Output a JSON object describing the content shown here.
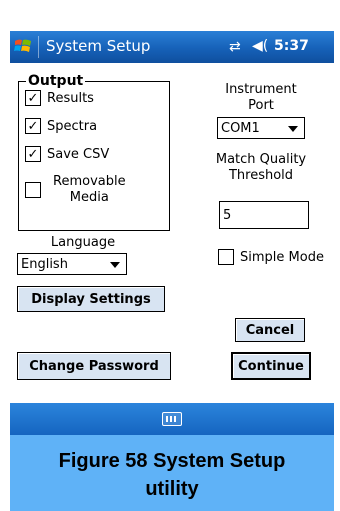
{
  "titlebar": {
    "title": "System Setup",
    "time": "5:37",
    "connectivity_icon": "⇄",
    "volume_icon": "◀("
  },
  "output_group": {
    "legend": "Output",
    "items": [
      {
        "label": "Results",
        "checked": true
      },
      {
        "label": "Spectra",
        "checked": true
      },
      {
        "label": "Save CSV",
        "checked": true
      },
      {
        "label_line1": "Removable",
        "label_line2": "Media",
        "checked": false
      }
    ]
  },
  "instrument_port": {
    "label_line1": "Instrument",
    "label_line2": "Port",
    "value": "COM1"
  },
  "match_quality": {
    "label_line1": "Match Quality",
    "label_line2": "Threshold",
    "value": "5"
  },
  "simple_mode": {
    "label": "Simple Mode",
    "checked": false
  },
  "language": {
    "label": "Language",
    "value": "English"
  },
  "buttons": {
    "display_settings": "Display Settings",
    "change_password": "Change Password",
    "cancel": "Cancel",
    "continue": "Continue"
  },
  "caption": {
    "line1": "Figure 58  System Setup",
    "line2": "utility"
  },
  "colors": {
    "titlebar": "#1661b8",
    "button_face": "#d8e4f2",
    "caption_bg": "#5fb2f7"
  }
}
